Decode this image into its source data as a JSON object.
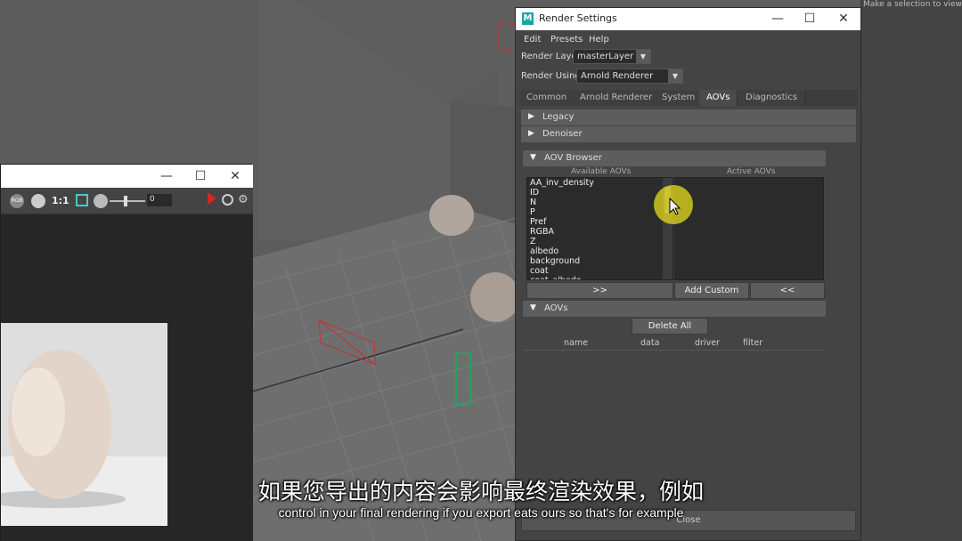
{
  "right_panel": {
    "hint": "Make a selection to view a"
  },
  "render_view": {
    "window_buttons": {
      "minimize": "—",
      "maximize": "☐",
      "close": "✕"
    },
    "toolbar": {
      "rgb_label": "RGB",
      "ratio_label": "1:1",
      "exposure_value": "0"
    }
  },
  "render_settings": {
    "title": "Render Settings",
    "logo": "M",
    "window_buttons": {
      "minimize": "—",
      "maximize": "☐",
      "close": "✕"
    },
    "menu": [
      "Edit",
      "Presets",
      "Help"
    ],
    "render_layer": {
      "label": "Render Layer",
      "value": "masterLayer"
    },
    "render_using": {
      "label": "Render Using",
      "value": "Arnold Renderer"
    },
    "tabs": [
      "Common",
      "Arnold Renderer",
      "System",
      "AOVs",
      "Diagnostics"
    ],
    "active_tab": "AOVs",
    "sections": {
      "legacy": "Legacy",
      "denoiser": "Denoiser",
      "aov_browser": "AOV Browser",
      "aovs": "AOVs"
    },
    "aov_browser": {
      "available_label": "Available AOVs",
      "active_label": "Active AOVs",
      "available": [
        "AA_inv_density",
        "ID",
        "N",
        "P",
        "Pref",
        "RGBA",
        "Z",
        "albedo",
        "background",
        "coat"
      ],
      "partial_item": "coat_albedo",
      "add_button": ">>",
      "add_custom_button": "Add Custom",
      "remove_button": "<<"
    },
    "aovs": {
      "delete_all_button": "Delete All",
      "columns": [
        "name",
        "data",
        "driver",
        "filter"
      ]
    },
    "close_button": "Close"
  },
  "subtitles": {
    "chinese": "如果您导出的内容会影响最终渲染效果，例如",
    "english": "control in your final rendering if you export eats ours so that's for example"
  }
}
